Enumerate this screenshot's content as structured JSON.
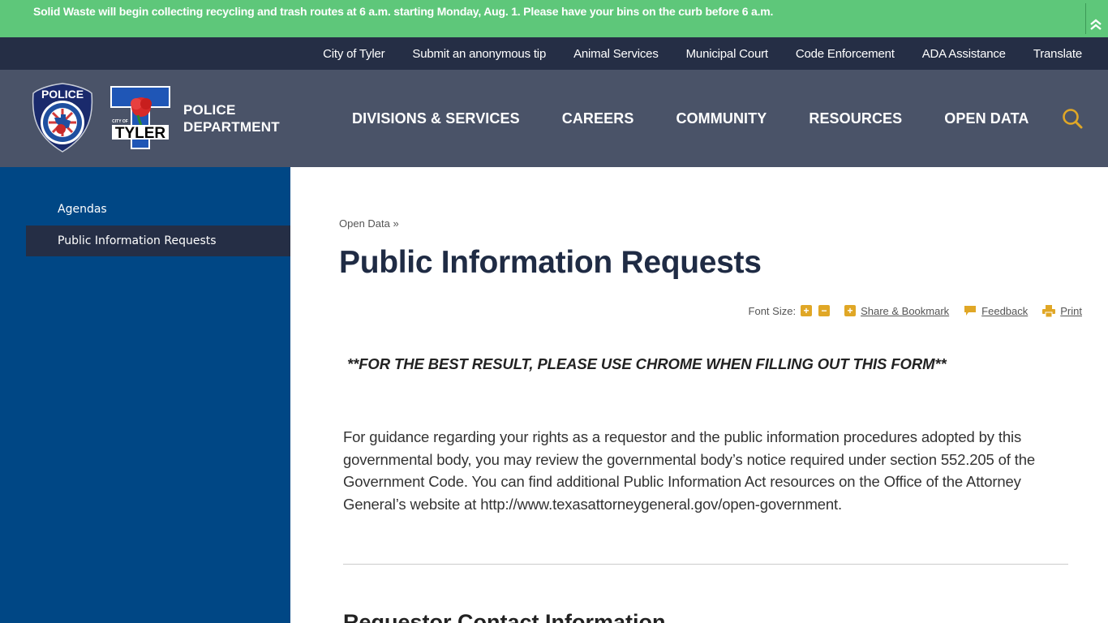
{
  "alert": {
    "message": "Solid Waste will begin collecting recycling and trash routes at 6 a.m. starting Monday, Aug. 1. Please have your bins on the curb before 6 a.m.",
    "collapse_icon": "double-chevron-up-icon"
  },
  "utility_nav": {
    "items": [
      {
        "label": "City of Tyler"
      },
      {
        "label": "Submit an anonymous tip"
      },
      {
        "label": "Animal Services"
      },
      {
        "label": "Municipal Court"
      },
      {
        "label": "Code Enforcement"
      },
      {
        "label": "ADA Assistance"
      },
      {
        "label": "Translate"
      }
    ]
  },
  "header": {
    "badge_text": "POLICE",
    "logo_text": "TYLER",
    "logo_small_text": "CITY OF",
    "dept_line1": "POLICE",
    "dept_line2": "DEPARTMENT",
    "nav": [
      {
        "label": "DIVISIONS & SERVICES"
      },
      {
        "label": "CAREERS"
      },
      {
        "label": "COMMUNITY"
      },
      {
        "label": "RESOURCES"
      },
      {
        "label": "OPEN DATA"
      }
    ],
    "search_icon": "search-icon"
  },
  "sidebar": {
    "items": [
      {
        "label": "Agendas",
        "active": false
      },
      {
        "label": "Public Information Requests",
        "active": true
      }
    ]
  },
  "content": {
    "breadcrumb": "Open Data",
    "breadcrumb_sep": "»",
    "title": "Public Information Requests",
    "tools": {
      "font_size_label": "Font Size:",
      "increase": "+",
      "decrease": "−",
      "share_plus": "+",
      "share": "Share & Bookmark",
      "feedback": "Feedback",
      "print": "Print"
    },
    "notice": "**FOR THE BEST RESULT, PLEASE USE CHROME WHEN FILLING OUT THIS FORM**",
    "paragraph": "For guidance regarding your rights as a requestor and the public information procedures adopted by this governmental body, you may review the governmental body’s notice required under section 552.205 of the Government Code. You can find additional Public Information Act resources on the Office of the Attorney General’s website at http://www.texasattorneygeneral.gov/open-government.",
    "section_heading": "Requestor Contact Information"
  },
  "colors": {
    "alert_bg": "#5ec77a",
    "utility_bg": "#252e45",
    "header_bg": "#4a5368",
    "sidebar_bg": "#004785",
    "accent": "#e0a726",
    "title": "#1f2b44"
  }
}
